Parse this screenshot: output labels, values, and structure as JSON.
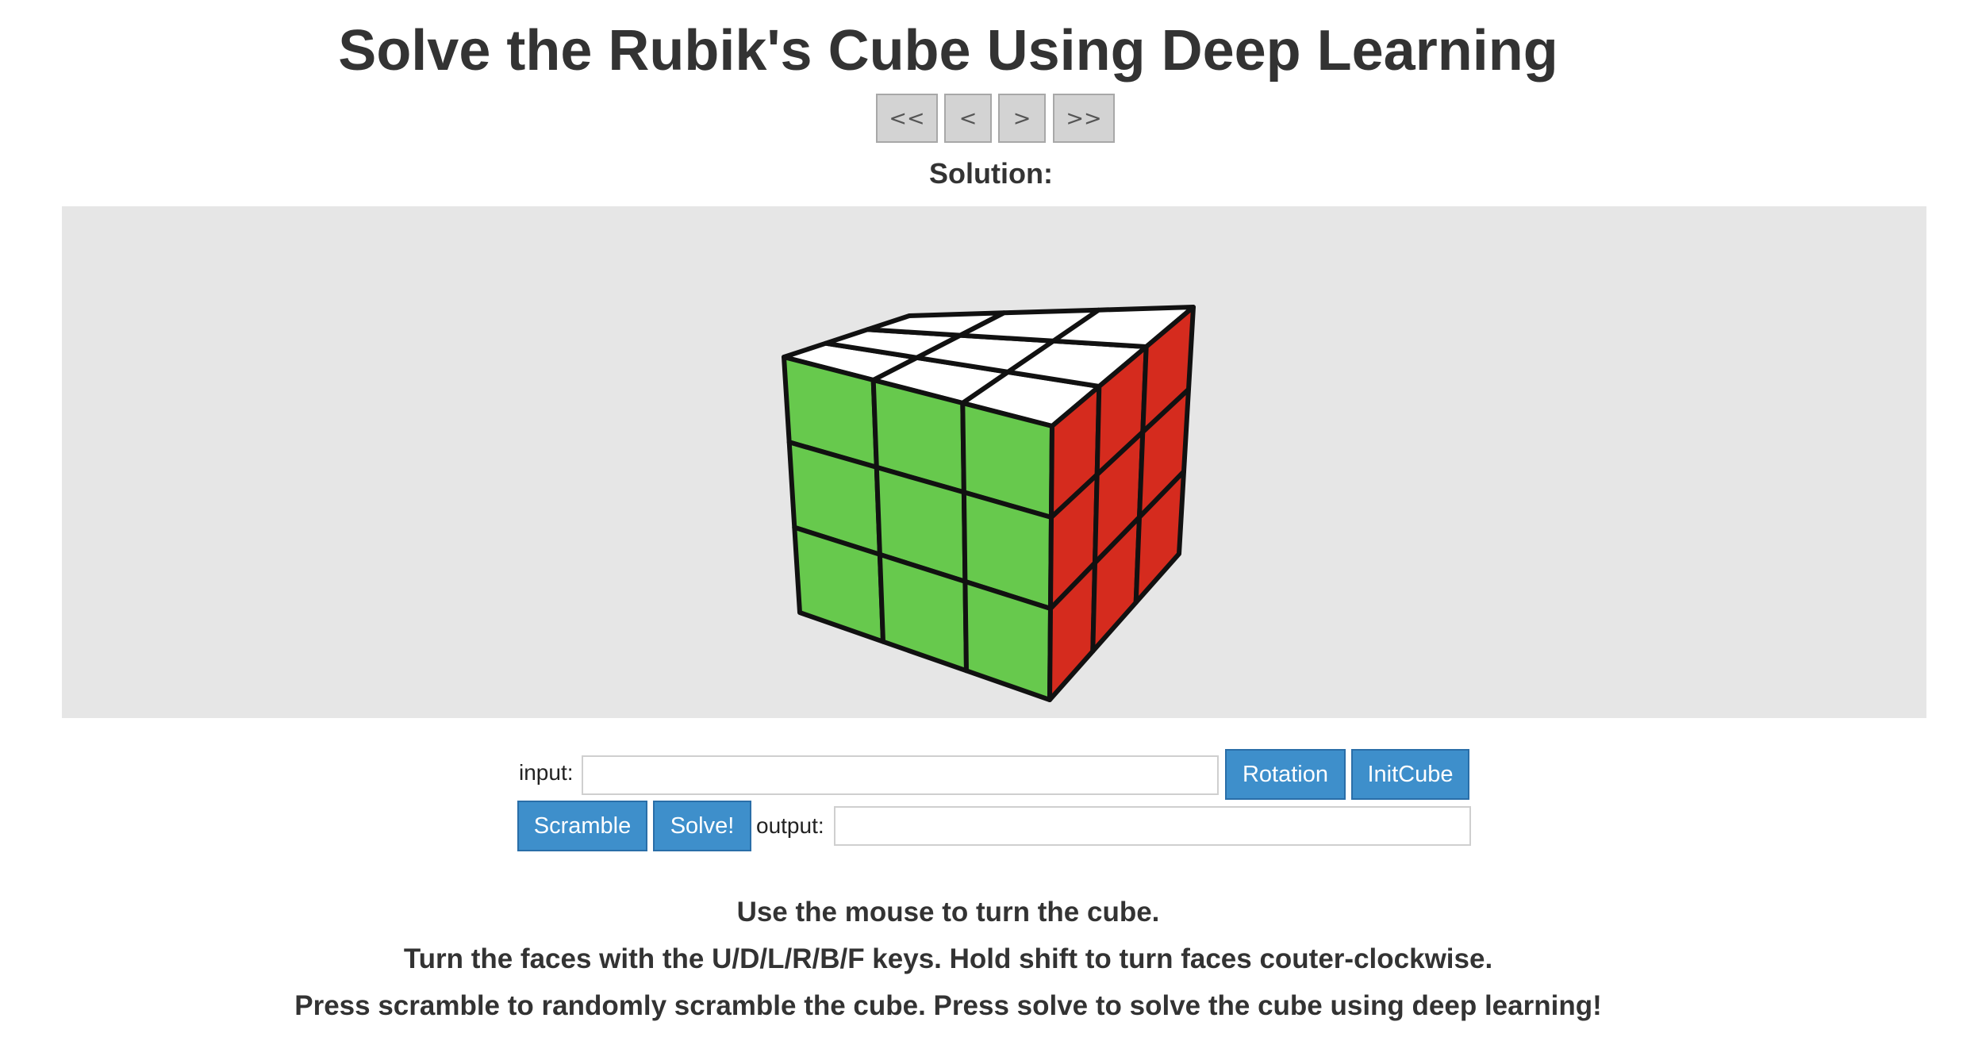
{
  "title": "Solve the Rubik's Cube Using Deep Learning",
  "nav": {
    "first": "<<",
    "prev": "<",
    "next": ">",
    "last": ">>"
  },
  "solution_label": "Solution:",
  "cube": {
    "faces": {
      "top": [
        "white",
        "white",
        "white",
        "white",
        "white",
        "white",
        "white",
        "white",
        "white"
      ],
      "front": [
        "green",
        "green",
        "green",
        "green",
        "green",
        "green",
        "green",
        "green",
        "green"
      ],
      "right": [
        "red",
        "red",
        "red",
        "red",
        "red",
        "red",
        "red",
        "red",
        "red"
      ]
    },
    "colors": {
      "white": "#ffffff",
      "green": "#67c94d",
      "red": "#d52b1e",
      "edge": "#111111",
      "background": "#e6e6e6"
    }
  },
  "controls": {
    "input_label": "input:",
    "input_value": "",
    "rotation_button": "Rotation",
    "initcube_button": "InitCube",
    "scramble_button": "Scramble",
    "solve_button": "Solve!",
    "output_label": "output:",
    "output_value": ""
  },
  "instructions": [
    "Use the mouse to turn the cube.",
    "Turn the faces with the U/D/L/R/B/F keys. Hold shift to turn faces couter-clockwise.",
    "Press scramble to randomly scramble the cube. Press solve to solve the cube using deep learning!"
  ],
  "accent_color": "#3e8fcb"
}
